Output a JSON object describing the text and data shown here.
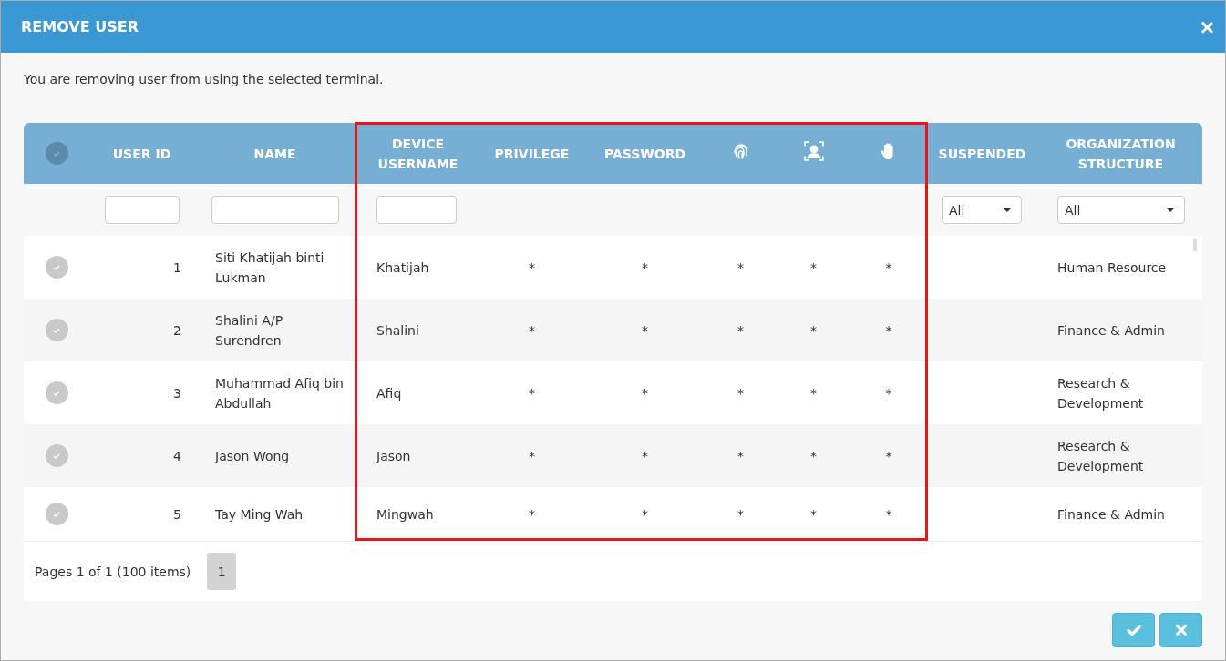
{
  "window": {
    "title": "REMOVE USER",
    "close": "×"
  },
  "message": "You are removing user from using the selected terminal.",
  "table": {
    "select_all": {
      "selected": false
    },
    "columns": [
      {
        "kind": "select"
      },
      {
        "kind": "text",
        "label": "USER ID",
        "filter": {
          "kind": "input"
        }
      },
      {
        "kind": "text",
        "label": "NAME",
        "filter": {
          "kind": "input"
        }
      },
      {
        "kind": "text",
        "label": "DEVICE USERNAME",
        "filter": {
          "kind": "input"
        }
      },
      {
        "kind": "text",
        "label": "PRIVILEGE"
      },
      {
        "kind": "text",
        "label": "PASSWORD"
      },
      {
        "kind": "fingerprint"
      },
      {
        "kind": "face"
      },
      {
        "kind": "palm"
      },
      {
        "kind": "text",
        "label": "SUSPENDED",
        "filter": {
          "kind": "select",
          "value": "All"
        }
      },
      {
        "kind": "text",
        "label": "ORGANIZATION STRUCTURE",
        "filter": {
          "kind": "select",
          "value": "All"
        }
      }
    ],
    "rows": [
      {
        "selected": false,
        "cells": [
          "",
          "1",
          "Siti Khatijah binti Lukman",
          "Khatijah",
          "*",
          "*",
          "*",
          "*",
          "*",
          "",
          "Human Resource"
        ]
      },
      {
        "selected": false,
        "cells": [
          "",
          "2",
          "Shalini A/P Surendren",
          "Shalini",
          "*",
          "*",
          "*",
          "*",
          "*",
          "",
          "Finance & Admin"
        ]
      },
      {
        "selected": false,
        "cells": [
          "",
          "3",
          "Muhammad Afiq bin Abdullah",
          "Afiq",
          "*",
          "*",
          "*",
          "*",
          "*",
          "",
          "Research & Development"
        ]
      },
      {
        "selected": false,
        "cells": [
          "",
          "4",
          "Jason Wong",
          "Jason",
          "*",
          "*",
          "*",
          "*",
          "*",
          "",
          "Research & Development"
        ]
      },
      {
        "selected": false,
        "cells": [
          "",
          "5",
          "Tay Ming Wah",
          "Mingwah",
          "*",
          "*",
          "*",
          "*",
          "*",
          "",
          "Finance & Admin"
        ]
      }
    ]
  },
  "pager": {
    "summary": "Pages 1 of 1 (100 items)",
    "pages": [
      {
        "label": "1",
        "selected": true
      }
    ]
  }
}
